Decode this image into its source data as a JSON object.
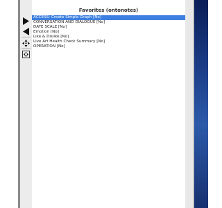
{
  "panel": {
    "title": "Favorites (ontonotes)",
    "items": [
      "ACCESS: Create Simple Graph [No]",
      "CONVERSATION AND DIALOGUE [No]",
      "DATE SCALE [No]",
      "Emotion [No]",
      "Like & Dislike [No]",
      "Live Art Health Check Summary [No]",
      "OPERATION [No]"
    ],
    "selected_index": 0
  },
  "toolbar": {
    "buttons": [
      {
        "name": "play-icon"
      },
      {
        "name": "rewind-icon"
      },
      {
        "name": "move-icon"
      },
      {
        "name": "fit-window-icon"
      }
    ]
  },
  "colors": {
    "selection": "#3d7fe0",
    "desktop": "#1d3f8a"
  }
}
